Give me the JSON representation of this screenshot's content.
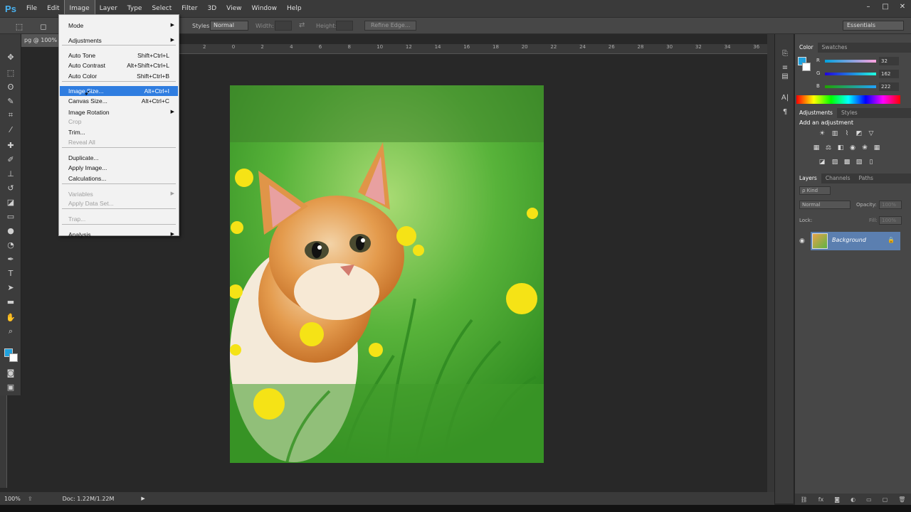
{
  "app": {
    "logo": "Ps"
  },
  "menubar": [
    "File",
    "Edit",
    "Image",
    "Layer",
    "Type",
    "Select",
    "Filter",
    "3D",
    "View",
    "Window",
    "Help"
  ],
  "window_controls": [
    "–",
    "□",
    "✕"
  ],
  "options_bar": {
    "styles_label": "Styles",
    "styles_value": "Normal",
    "width_label": "Width:",
    "height_label": "Height:",
    "refine_edge": "Refine Edge..."
  },
  "document": {
    "tab_title": "pg @ 100% (R",
    "zoom": "100%",
    "doc_info": "Doc: 1.22M/1.22M"
  },
  "ruler_numbers": [
    "2",
    "0",
    "2",
    "4",
    "6",
    "8",
    "10",
    "12",
    "14",
    "16",
    "18",
    "20",
    "22",
    "24",
    "26",
    "28",
    "30",
    "32",
    "34",
    "36"
  ],
  "image_menu": {
    "items": [
      {
        "label": "Mode",
        "shortcut": "",
        "submenu": true,
        "disabled": false
      },
      {
        "label": "Adjustments",
        "shortcut": "",
        "submenu": true,
        "disabled": false
      },
      {
        "label": "Auto Tone",
        "shortcut": "Shift+Ctrl+L",
        "submenu": false,
        "disabled": false
      },
      {
        "label": "Auto Contrast",
        "shortcut": "Alt+Shift+Ctrl+L",
        "submenu": false,
        "disabled": false
      },
      {
        "label": "Auto Color",
        "shortcut": "Shift+Ctrl+B",
        "submenu": false,
        "disabled": false
      },
      {
        "label": "Image Size...",
        "shortcut": "Alt+Ctrl+I",
        "submenu": false,
        "disabled": false,
        "highlighted": true
      },
      {
        "label": "Canvas Size...",
        "shortcut": "Alt+Ctrl+C",
        "submenu": false,
        "disabled": false
      },
      {
        "label": "Image Rotation",
        "shortcut": "",
        "submenu": true,
        "disabled": false
      },
      {
        "label": "Crop",
        "shortcut": "",
        "submenu": false,
        "disabled": true
      },
      {
        "label": "Trim...",
        "shortcut": "",
        "submenu": false,
        "disabled": false
      },
      {
        "label": "Reveal All",
        "shortcut": "",
        "submenu": false,
        "disabled": true
      },
      {
        "label": "Duplicate...",
        "shortcut": "",
        "submenu": false,
        "disabled": false
      },
      {
        "label": "Apply Image...",
        "shortcut": "",
        "submenu": false,
        "disabled": false
      },
      {
        "label": "Calculations...",
        "shortcut": "",
        "submenu": false,
        "disabled": false
      },
      {
        "label": "Variables",
        "shortcut": "",
        "submenu": true,
        "disabled": true
      },
      {
        "label": "Apply Data Set...",
        "shortcut": "",
        "submenu": false,
        "disabled": true
      },
      {
        "label": "Trap...",
        "shortcut": "",
        "submenu": false,
        "disabled": true
      },
      {
        "label": "Analysis",
        "shortcut": "",
        "submenu": true,
        "disabled": false
      }
    ]
  },
  "workspace": "Essentials",
  "color_panel": {
    "tabs": [
      "Color",
      "Swatches"
    ],
    "r_label": "R",
    "r_value": "32",
    "g_label": "G",
    "g_value": "162",
    "b_label": "B",
    "b_value": "222",
    "foreground": "#20a2de"
  },
  "adjustments_panel": {
    "tabs": [
      "Adjustments",
      "Styles"
    ],
    "title": "Add an adjustment"
  },
  "layers_panel": {
    "tabs": [
      "Layers",
      "Channels",
      "Paths"
    ],
    "filter": "ρ Kind",
    "blend_mode": "Normal",
    "opacity_label": "Opacity:",
    "opacity_value": "100%",
    "lock_label": "Lock:",
    "fill_label": "Fill:",
    "fill_value": "100%",
    "layer_name": "Background"
  }
}
